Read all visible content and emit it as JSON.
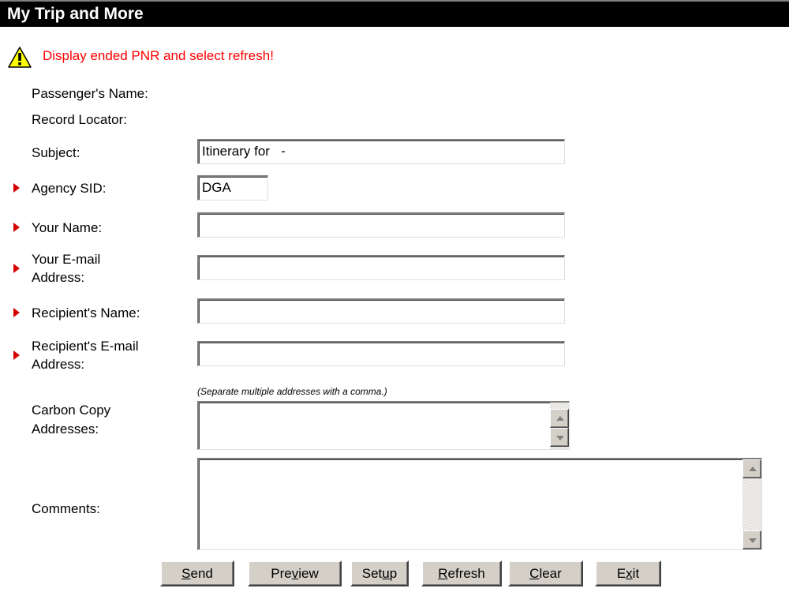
{
  "window": {
    "title": "My Trip and More"
  },
  "warning": {
    "icon": "warning-icon",
    "text": "Display ended PNR and select refresh!",
    "color": "#ff0000"
  },
  "form": {
    "passenger_name_label": "Passenger's Name:",
    "record_locator_label": "Record Locator:",
    "subject_label": "Subject:",
    "subject_value": "Itinerary for   -",
    "agency_sid_label": "Agency SID:",
    "agency_sid_value": "DGA",
    "your_name_label": "Your Name:",
    "your_name_value": "",
    "your_email_label_1": "Your E-mail",
    "your_email_label_2": "Address:",
    "your_email_value": "",
    "recipient_name_label": "Recipient's Name:",
    "recipient_name_value": "",
    "recipient_email_label_1": "Recipient's E-mail",
    "recipient_email_label_2": "Address:",
    "recipient_email_value": "",
    "cc_hint": "(Separate multiple addresses with a comma.)",
    "cc_label_1": "Carbon Copy",
    "cc_label_2": "Addresses:",
    "comments_label": "Comments:",
    "required_marker_color": "#d40000"
  },
  "buttons": [
    {
      "label": "Send",
      "mnemonic": "S"
    },
    {
      "label": "Preview",
      "mnemonic": "v"
    },
    {
      "label": "Setup",
      "mnemonic": "u"
    },
    {
      "label": "Refresh",
      "mnemonic": "R"
    },
    {
      "label": "Clear",
      "mnemonic": "C"
    },
    {
      "label": "Exit",
      "mnemonic": "x"
    }
  ]
}
